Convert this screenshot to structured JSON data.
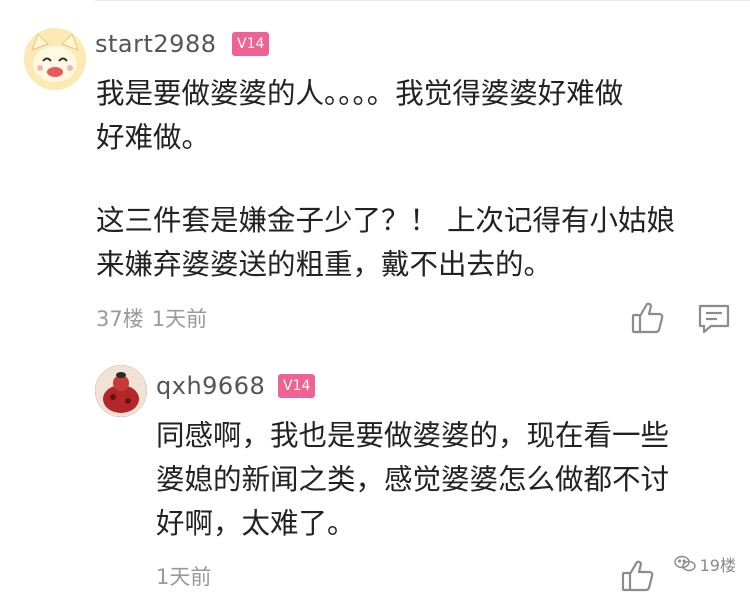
{
  "comment": {
    "username": "start2988",
    "badge": "V14",
    "lines": [
      "我是要做婆婆的人。。。。我觉得婆婆好难做",
      "好难做。",
      "",
      "这三件套是嫌金子少了？！ 上次记得有小姑娘",
      "来嫌弃婆婆送的粗重，戴不出去的。"
    ],
    "floor": "37楼",
    "time": "1天前",
    "avatar_icon": "cartoon-cat-avatar-icon",
    "like_icon": "thumbs-up-icon",
    "reply_icon": "comment-icon"
  },
  "reply": {
    "username": "qxh9668",
    "badge": "V14",
    "lines": [
      "同感啊，我也是要做婆婆的，现在看一些",
      "婆媳的新闻之类，感觉婆婆怎么做都不讨",
      "好啊，太难了。"
    ],
    "time": "1天前",
    "avatar_icon": "photo-avatar-icon",
    "like_icon": "thumbs-up-icon"
  },
  "watermark": {
    "text": "19楼",
    "icon": "wechat-icon"
  },
  "colors": {
    "badge": "#f06292",
    "text": "#222222",
    "meta": "#9a9a9a",
    "username": "#555555"
  }
}
